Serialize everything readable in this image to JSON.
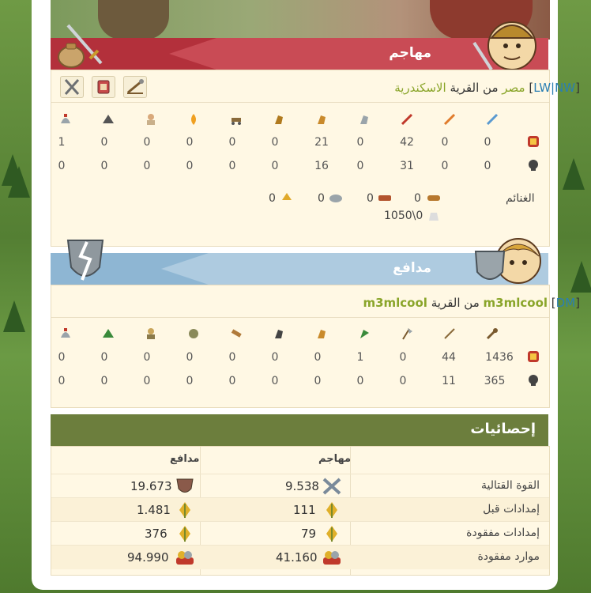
{
  "attacker": {
    "title": "مهاجم",
    "player_tag": "LW|NW",
    "player_name": "مصر",
    "from_label": "من القرية",
    "village": "الاسكندرية",
    "tools": [
      "swords-crossed-icon",
      "shield-box-icon",
      "catapult-icon"
    ],
    "unit_icons": [
      "legionnaire-icon",
      "praetorian-icon",
      "imperian-icon",
      "equites-legati-icon",
      "equites-imperatoris-icon",
      "equites-caesaris-icon",
      "battering-ram-icon",
      "fire-catapult-icon",
      "senator-icon",
      "settler-icon",
      "hero-helmet-icon"
    ],
    "troops": [
      "0",
      "0",
      "42",
      "0",
      "21",
      "0",
      "0",
      "0",
      "0",
      "0",
      "1"
    ],
    "losses": [
      "0",
      "0",
      "31",
      "0",
      "16",
      "0",
      "0",
      "0",
      "0",
      "0",
      "0"
    ],
    "loot_label": "الغنائم",
    "loot": [
      "0",
      "0",
      "0",
      "0"
    ],
    "capacity": "1050\\0"
  },
  "defender": {
    "title": "مدافع",
    "player_tag": "DM",
    "player_name": "m3mlcool",
    "from_label": "من القرية",
    "village": "m3mlcool",
    "unit_icons": [
      "club-icon",
      "spear-icon",
      "axe-icon",
      "scout-icon",
      "paladin-icon",
      "teuton-knight-icon",
      "ram-icon",
      "catapult-icon",
      "chief-icon",
      "settler-icon",
      "hero-helmet-icon"
    ],
    "troops": [
      "1436",
      "44",
      "0",
      "1",
      "0",
      "0",
      "0",
      "0",
      "0",
      "0",
      "0"
    ],
    "losses": [
      "365",
      "11",
      "0",
      "0",
      "0",
      "0",
      "0",
      "0",
      "0",
      "0",
      "0"
    ]
  },
  "stats": {
    "title": "إحصائيات",
    "col_attacker": "مهاجم",
    "col_defender": "مدافع",
    "rows": [
      {
        "label": "القوة القتالية",
        "attacker": "9.538",
        "defender": "19.673"
      },
      {
        "label": "إمدادات قبل",
        "attacker": "111",
        "defender": "1.481"
      },
      {
        "label": "إمدادات مفقودة",
        "attacker": "79",
        "defender": "376"
      },
      {
        "label": "موارد مفقودة",
        "attacker": "41.160",
        "defender": "94.990"
      }
    ]
  },
  "colors": {
    "attacker_band": "#b3303b",
    "defender_band": "#8eb6d3",
    "stats_band": "#6c7e3d",
    "link": "#8aa52a",
    "tag": "#2a7fb4"
  }
}
